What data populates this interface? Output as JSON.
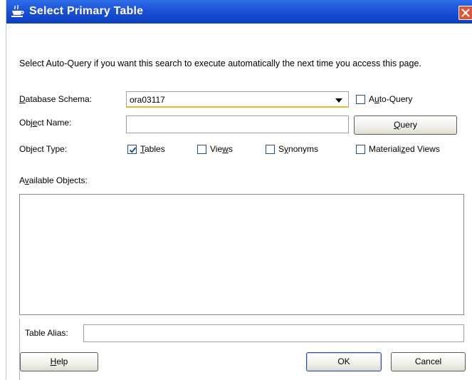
{
  "titlebar": {
    "title": "Select Primary Table"
  },
  "description": "Select Auto-Query if you want this search to execute automatically the next time you access this page.",
  "fields": {
    "schema": {
      "label_pre": "",
      "label_u": "D",
      "label_post": "atabase Schema:",
      "value": "ora03117"
    },
    "object_name": {
      "label_pre": "Obj",
      "label_u": "e",
      "label_post": "ct Name:",
      "value": ""
    },
    "object_type": {
      "label": "Object Type:"
    },
    "available": {
      "label_pre": "A",
      "label_u": "v",
      "label_post": "ailable Objects:"
    },
    "alias": {
      "label": "Table Alias:",
      "value": ""
    }
  },
  "checkboxes": {
    "auto_query": {
      "pre": "A",
      "u": "u",
      "post": "to-Query",
      "checked": false
    },
    "tables": {
      "pre": "",
      "u": "T",
      "post": "ables",
      "checked": true
    },
    "views": {
      "pre": "Vie",
      "u": "w",
      "post": "s",
      "checked": false
    },
    "synonyms": {
      "pre": "S",
      "u": "y",
      "post": "nonyms",
      "checked": false
    },
    "materialized": {
      "pre": "Materiali",
      "u": "z",
      "post": "ed Views",
      "checked": false
    }
  },
  "buttons": {
    "query": {
      "pre": "",
      "u": "Q",
      "post": "uery"
    },
    "help": {
      "pre": "",
      "u": "H",
      "post": "elp"
    },
    "ok": {
      "label": "OK"
    },
    "cancel": {
      "label": "Cancel"
    }
  },
  "colors": {
    "titlebar": "#1c52d8",
    "close": "#e0553a",
    "focus_underline": "#e8b437"
  },
  "icons": {
    "title": "coffee-cup-icon",
    "close": "close-icon",
    "dropdown": "chevron-down-icon",
    "check": "checkmark-icon"
  }
}
